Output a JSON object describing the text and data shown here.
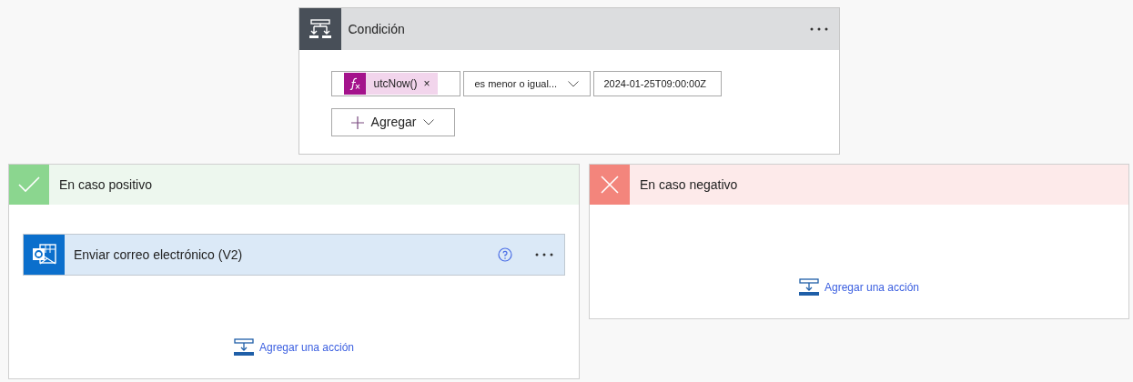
{
  "condition": {
    "title": "Condición",
    "operand": {
      "label": "utcNow()",
      "remove": "×"
    },
    "operator": "es menor o igual...",
    "value": "2024-01-25T09:00:00Z",
    "add_button": "Agregar"
  },
  "branches": [
    {
      "kind": "positive",
      "title": "En caso positivo",
      "actions": [
        {
          "title": "Enviar correo electrónico (V2)"
        }
      ],
      "add_action": "Agregar una acción"
    },
    {
      "kind": "negative",
      "title": "En caso negativo",
      "add_action": "Agregar una acción"
    }
  ]
}
